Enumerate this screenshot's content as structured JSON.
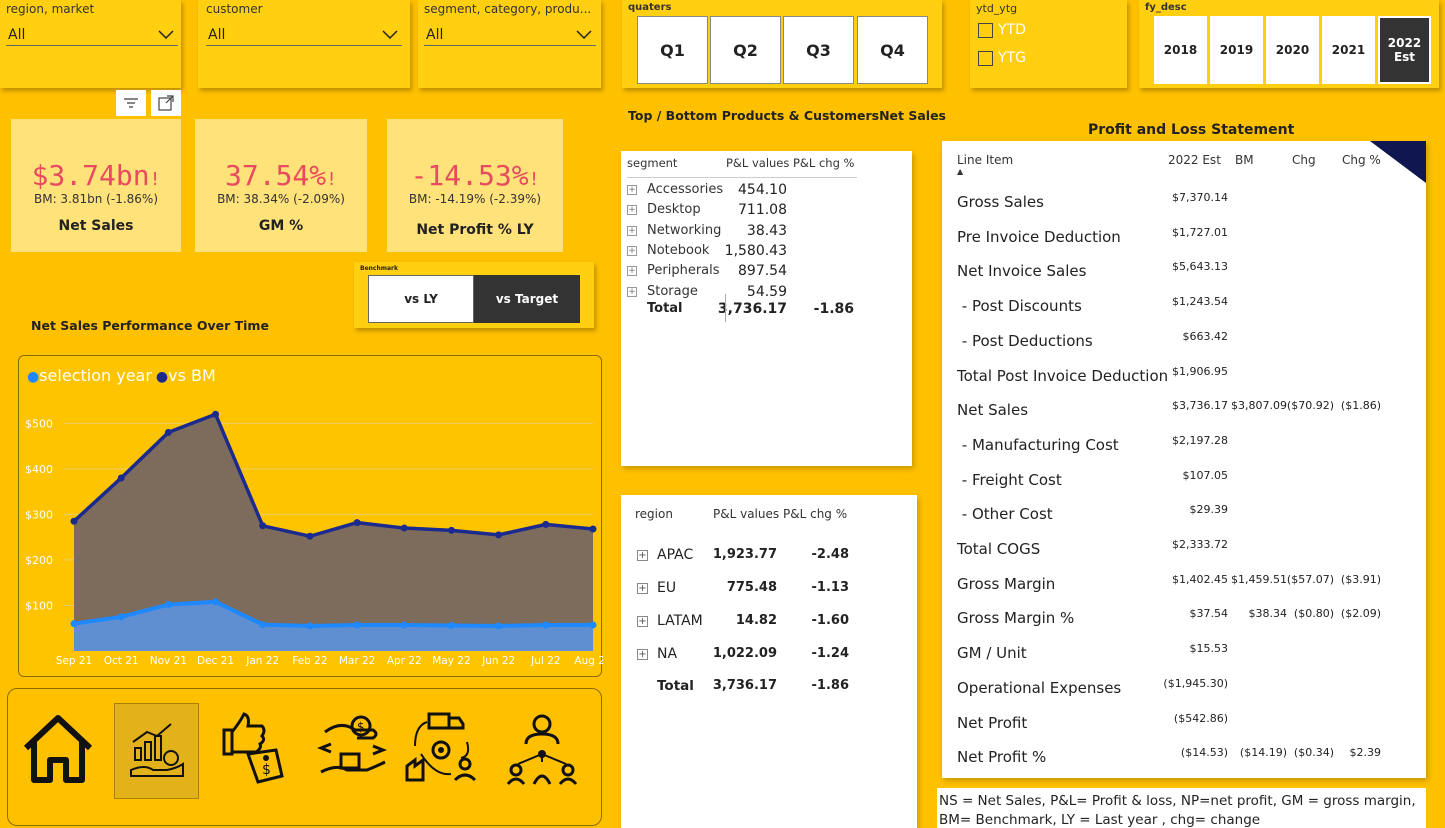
{
  "slicers": {
    "region": {
      "title": "region, market",
      "value": "All"
    },
    "customer": {
      "title": "customer",
      "value": "All"
    },
    "segment": {
      "title": "segment, category, produ...",
      "value": "All"
    },
    "quarters": {
      "title": "quaters",
      "items": [
        "Q1",
        "Q2",
        "Q3",
        "Q4"
      ]
    },
    "ytd": {
      "title": "ytd_ytg",
      "items": [
        "YTD",
        "YTG"
      ]
    },
    "fy": {
      "title": "fy_desc",
      "items": [
        "2018",
        "2019",
        "2020",
        "2021"
      ],
      "active_line1": "2022",
      "active_line2": "Est"
    }
  },
  "kpis": [
    {
      "value": "$3.74bn",
      "bm": "BM: 3.81bn (-1.86%)",
      "label": "Net Sales"
    },
    {
      "value": "37.54%",
      "bm": "BM: 38.34% (-2.09%)",
      "label": "GM %"
    },
    {
      "value": "-14.53%",
      "bm": "BM: -14.19% (-2.39%)",
      "label": "Net Profit % LY"
    }
  ],
  "kpi_alert": "!",
  "benchmark": {
    "title": "Benchmark",
    "vs_ly": "vs LY",
    "vs_target": "vs Target"
  },
  "chart_title": "Net Sales Performance Over Time",
  "chart_data": {
    "type": "area",
    "categories": [
      "Sep 21",
      "Oct 21",
      "Nov 21",
      "Dec 21",
      "Jan 22",
      "Feb 22",
      "Mar 22",
      "Apr 22",
      "May 22",
      "Jun 22",
      "Jul 22",
      "Aug 22"
    ],
    "series": [
      {
        "name": "selection year",
        "color": "#1e88ff",
        "values": [
          60,
          75,
          102,
          108,
          58,
          55,
          57,
          57,
          56,
          55,
          57,
          57
        ]
      },
      {
        "name": "vs BM",
        "color": "#1b2a8f",
        "values": [
          285,
          380,
          480,
          520,
          275,
          252,
          282,
          270,
          265,
          255,
          278,
          268
        ]
      }
    ],
    "yticks": [
      "$100",
      "$200",
      "$300",
      "$400",
      "$500"
    ],
    "ylim": [
      0,
      560
    ],
    "legend": "top-left"
  },
  "products_title": "Top / Bottom Products & CustomersNet Sales",
  "segment_table": {
    "headers": [
      "segment",
      "P&L values",
      "P&L chg %"
    ],
    "rows": [
      {
        "name": "Accessories",
        "value": "454.10"
      },
      {
        "name": "Desktop",
        "value": "711.08"
      },
      {
        "name": "Networking",
        "value": "38.43"
      },
      {
        "name": "Notebook",
        "value": "1,580.43"
      },
      {
        "name": "Peripherals",
        "value": "897.54"
      },
      {
        "name": "Storage",
        "value": "54.59"
      }
    ],
    "total": {
      "name": "Total",
      "value": "3,736.17",
      "chg": "-1.86"
    }
  },
  "region_table": {
    "headers": [
      "region",
      "P&L values",
      "P&L chg %"
    ],
    "rows": [
      {
        "name": "APAC",
        "value": "1,923.77",
        "chg": "-2.48"
      },
      {
        "name": "EU",
        "value": "775.48",
        "chg": "-1.13"
      },
      {
        "name": "LATAM",
        "value": "14.82",
        "chg": "-1.60"
      },
      {
        "name": "NA",
        "value": "1,022.09",
        "chg": "-1.24"
      }
    ],
    "total": {
      "name": "Total",
      "value": "3,736.17",
      "chg": "-1.86"
    }
  },
  "pl": {
    "title": "Profit and Loss Statement",
    "headers": [
      "Line Item",
      "2022 Est",
      "BM",
      "Chg",
      "Chg %"
    ],
    "rows": [
      {
        "item": "Gross Sales",
        "est": "$7,370.14",
        "bm": "",
        "chg": "",
        "chgp": ""
      },
      {
        "item": "Pre Invoice Deduction",
        "est": "$1,727.01",
        "bm": "",
        "chg": "",
        "chgp": ""
      },
      {
        "item": "Net Invoice Sales",
        "est": "$5,643.13",
        "bm": "",
        "chg": "",
        "chgp": ""
      },
      {
        "item": " - Post Discounts",
        "est": "$1,243.54",
        "bm": "",
        "chg": "",
        "chgp": ""
      },
      {
        "item": " - Post Deductions",
        "est": "$663.42",
        "bm": "",
        "chg": "",
        "chgp": ""
      },
      {
        "item": "Total Post Invoice Deduction",
        "est": "$1,906.95",
        "bm": "",
        "chg": "",
        "chgp": ""
      },
      {
        "item": "Net Sales",
        "est": "$3,736.17",
        "bm": "$3,807.09",
        "chg": "($70.92)",
        "chgp": "($1.86)"
      },
      {
        "item": " - Manufacturing Cost",
        "est": "$2,197.28",
        "bm": "",
        "chg": "",
        "chgp": ""
      },
      {
        "item": " - Freight Cost",
        "est": "$107.05",
        "bm": "",
        "chg": "",
        "chgp": ""
      },
      {
        "item": " - Other Cost",
        "est": "$29.39",
        "bm": "",
        "chg": "",
        "chgp": ""
      },
      {
        "item": "Total COGS",
        "est": "$2,333.72",
        "bm": "",
        "chg": "",
        "chgp": ""
      },
      {
        "item": "Gross Margin",
        "est": "$1,402.45",
        "bm": "$1,459.51",
        "chg": "($57.07)",
        "chgp": "($3.91)"
      },
      {
        "item": "Gross Margin %",
        "est": "$37.54",
        "bm": "$38.34",
        "chg": "($0.80)",
        "chgp": "($2.09)"
      },
      {
        "item": "GM / Unit",
        "est": "$15.53",
        "bm": "",
        "chg": "",
        "chgp": ""
      },
      {
        "item": "Operational Expenses",
        "est": "($1,945.30)",
        "bm": "",
        "chg": "",
        "chgp": ""
      },
      {
        "item": "Net Profit",
        "est": "($542.86)",
        "bm": "",
        "chg": "",
        "chgp": ""
      },
      {
        "item": "Net Profit %",
        "est": "($14.53)",
        "bm": "($14.19)",
        "chg": "($0.34)",
        "chgp": "$2.39"
      }
    ]
  },
  "footnote": "NS = Net Sales, P&L= Profit & loss,  NP=net profit, GM = gross margin, BM= Benchmark, LY = Last year , chg= change",
  "nav_icons": [
    "home-icon",
    "finance-icon",
    "marketing-icon",
    "sales-icon",
    "supply-chain-icon",
    "executive-icon"
  ]
}
